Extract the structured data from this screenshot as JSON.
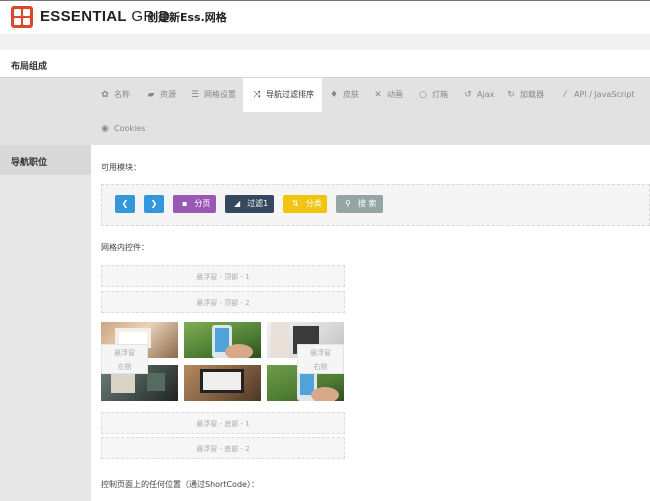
{
  "header": {
    "brand_bold": "ESSENTIAL",
    "brand_light": " GRID",
    "subtitle": "创建新Ess.网格"
  },
  "panel": {
    "title": "布局组成"
  },
  "tabs": [
    {
      "label": "名称",
      "icon": "gear-icon"
    },
    {
      "label": "资源",
      "icon": "folder-icon"
    },
    {
      "label": "网格设置",
      "icon": "list-icon"
    },
    {
      "label": "导航过滤排序",
      "icon": "shuffle-icon",
      "active": true
    },
    {
      "label": "皮肤",
      "icon": "drop-icon"
    },
    {
      "label": "动画",
      "icon": "tools-icon"
    },
    {
      "label": "灯箱",
      "icon": "search-icon"
    },
    {
      "label": "Ajax",
      "icon": "undo-icon"
    },
    {
      "label": "加载器",
      "icon": "history-icon"
    },
    {
      "label": "API / JavaScript",
      "icon": "magic-wand-icon"
    },
    {
      "label": "Cookies",
      "icon": "eye-icon"
    }
  ],
  "sidebar": {
    "active_item": "导航职位"
  },
  "main": {
    "available_modules_label": "可用模块：",
    "modules": [
      {
        "label": "",
        "icon": "chevron-left-icon",
        "color": "#3497d9"
      },
      {
        "label": "",
        "icon": "chevron-right-icon",
        "color": "#3497d9"
      },
      {
        "label": "分页",
        "icon": "pagination-icon",
        "color": "#9b59b6"
      },
      {
        "label": "过滤1",
        "icon": "filter-icon",
        "color": "#34495e"
      },
      {
        "label": "分类",
        "icon": "sort-icon",
        "color": "#f1c40f"
      },
      {
        "label": "搜 索",
        "icon": "search-icon",
        "color": "#95a5a6"
      }
    ],
    "in_grid_label": "网格内控件：",
    "top_slots": [
      "悬浮窗 - 顶部 - 1",
      "悬浮窗 - 顶部 - 2"
    ],
    "left_slot": [
      "悬浮窗",
      "左侧"
    ],
    "right_slot": [
      "悬浮窗",
      "右侧"
    ],
    "bottom_slots": [
      "悬浮窗 - 底部 - 1",
      "悬浮窗 - 底部 - 2"
    ],
    "shortcode_label": "控制页面上的任何位置（通过ShortCode）："
  },
  "colors": {
    "logo": "#d84a2b",
    "arrow_button": "#3497d9",
    "pagination": "#9b59b6",
    "filter": "#34495e",
    "sort": "#f1c40f",
    "search": "#95a5a6"
  }
}
